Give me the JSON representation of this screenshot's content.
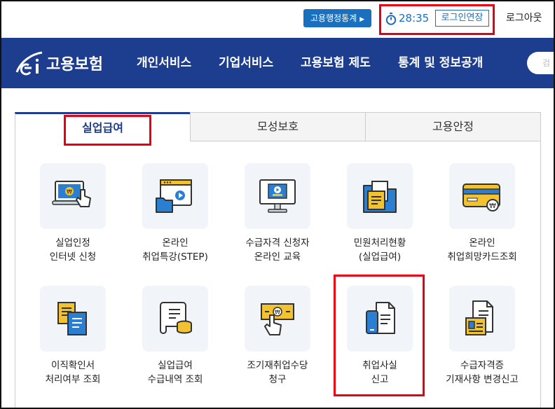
{
  "topbar": {
    "stats_button": "고용행정통계",
    "timer": "28:35",
    "extend_button": "로그인연장",
    "logout": "로그아웃"
  },
  "nav": {
    "logo_text": "고용보험",
    "items": [
      "개인서비스",
      "기업서비스",
      "고용보험 제도",
      "통계 및 정보공개"
    ],
    "search_placeholder": "검"
  },
  "tabs": [
    "실업급여",
    "모성보호",
    "고용안정"
  ],
  "services": [
    {
      "line1": "실업인정",
      "line2": "인터넷 신청",
      "icon": "laptop-hand-icon"
    },
    {
      "line1": "온라인",
      "line2": "취업특강(STEP)",
      "icon": "video-folder-icon"
    },
    {
      "line1": "수급자격 신청자",
      "line2": "온라인 교육",
      "icon": "monitor-play-icon"
    },
    {
      "line1": "민원처리현황",
      "line2": "(실업급여)",
      "icon": "folder-document-icon"
    },
    {
      "line1": "온라인",
      "line2": "취업희망카드조회",
      "icon": "card-won-icon"
    },
    {
      "line1": "이직확인서",
      "line2": "처리여부 조회",
      "icon": "documents-icon"
    },
    {
      "line1": "실업급여",
      "line2": "수급내역 조회",
      "icon": "scroll-coins-icon"
    },
    {
      "line1": "조기재취업수당",
      "line2": "청구",
      "icon": "banknote-hand-icon"
    },
    {
      "line1": "취업사실",
      "line2": "신고",
      "icon": "phone-document-icon"
    },
    {
      "line1": "수급자격증",
      "line2": "기재사항 변경신고",
      "icon": "certificate-edit-icon"
    }
  ],
  "colors": {
    "navy": "#1d3d8f",
    "blue": "#1b6fbf",
    "highlight_red": "#e60012",
    "icon_bg": "#f1f4f8"
  }
}
